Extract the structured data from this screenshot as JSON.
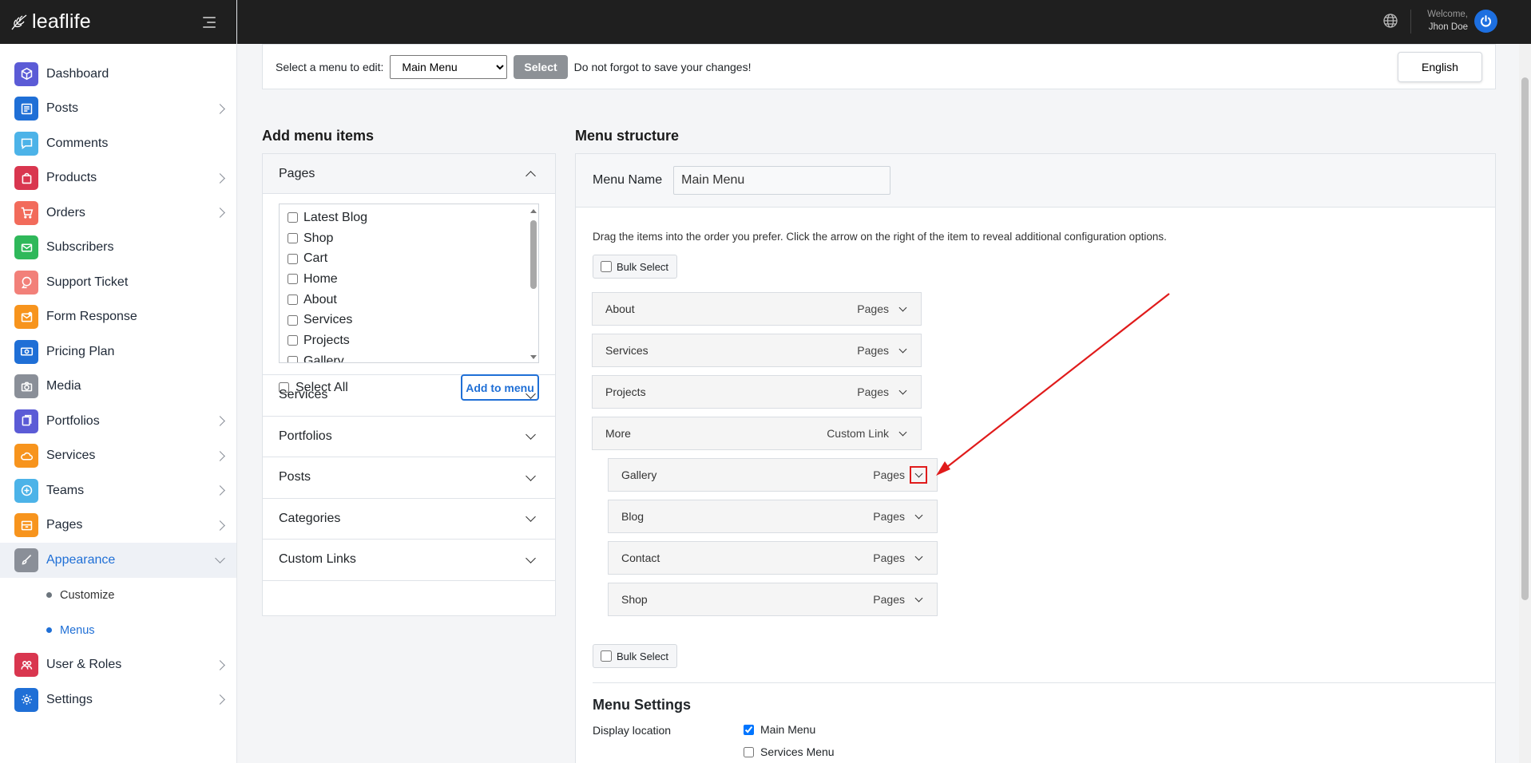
{
  "brand": {
    "name": "leaflife"
  },
  "sidebar": {
    "items": [
      {
        "label": "Dashboard",
        "icon": "cube-icon",
        "color": "#5b5bd6",
        "has_children": false
      },
      {
        "label": "Posts",
        "icon": "newspaper-icon",
        "color": "#1f6fd6",
        "has_children": true
      },
      {
        "label": "Comments",
        "icon": "comment-icon",
        "color": "#4cb3e8",
        "has_children": false
      },
      {
        "label": "Products",
        "icon": "bag-icon",
        "color": "#d9364f",
        "has_children": true
      },
      {
        "label": "Orders",
        "icon": "cart-icon",
        "color": "#f26b5b",
        "has_children": true
      },
      {
        "label": "Subscribers",
        "icon": "mail-icon",
        "color": "#2fb85a",
        "has_children": false
      },
      {
        "label": "Support Ticket",
        "icon": "support-icon",
        "color": "#f28079",
        "has_children": false
      },
      {
        "label": "Form Response",
        "icon": "mail-open-icon",
        "color": "#f7941d",
        "has_children": false
      },
      {
        "label": "Pricing Plan",
        "icon": "money-icon",
        "color": "#1f6fd6",
        "has_children": false
      },
      {
        "label": "Media",
        "icon": "camera-icon",
        "color": "#8a8f98",
        "has_children": false
      },
      {
        "label": "Portfolios",
        "icon": "portfolio-icon",
        "color": "#5b5bd6",
        "has_children": true
      },
      {
        "label": "Services",
        "icon": "cloud-icon",
        "color": "#f7941d",
        "has_children": true
      },
      {
        "label": "Teams",
        "icon": "plus-circle-icon",
        "color": "#4cb3e8",
        "has_children": true
      },
      {
        "label": "Pages",
        "icon": "pages-icon",
        "color": "#f7941d",
        "has_children": true
      },
      {
        "label": "Appearance",
        "icon": "brush-icon",
        "color": "#8a8f98",
        "has_children": true,
        "active": true
      },
      {
        "label": "User & Roles",
        "icon": "users-icon",
        "color": "#d9364f",
        "has_children": true
      },
      {
        "label": "Settings",
        "icon": "gear-icon",
        "color": "#1f6fd6",
        "has_children": true
      }
    ],
    "appearance_sub": [
      {
        "label": "Customize"
      },
      {
        "label": "Menus",
        "active": true
      }
    ]
  },
  "topbar": {
    "welcome": "Welcome,",
    "user": "Jhon Doe"
  },
  "selector": {
    "label": "Select a menu to edit:",
    "selected": "Main Menu",
    "select_button": "Select",
    "note": "Do not forgot to save your changes!",
    "language": "English"
  },
  "add_items": {
    "title": "Add menu items",
    "pages_label": "Pages",
    "pages": [
      "Latest Blog",
      "Shop",
      "Cart",
      "Home",
      "About",
      "Services",
      "Projects",
      "Gallery"
    ],
    "select_all": "Select All",
    "add_button": "Add to menu",
    "sections": [
      "Services",
      "Portfolios",
      "Posts",
      "Categories",
      "Custom Links"
    ]
  },
  "structure": {
    "title": "Menu structure",
    "name_label": "Menu Name",
    "name_value": "Main Menu",
    "hint": "Drag the items into the order you prefer. Click the arrow on the right of the item to reveal additional configuration options.",
    "bulk_select": "Bulk Select",
    "items": [
      {
        "label": "About",
        "type": "Pages",
        "level": 0
      },
      {
        "label": "Services",
        "type": "Pages",
        "level": 0
      },
      {
        "label": "Projects",
        "type": "Pages",
        "level": 0
      },
      {
        "label": "More",
        "type": "Custom Link",
        "level": 0
      },
      {
        "label": "Gallery",
        "type": "Pages",
        "level": 1,
        "highlighted": true
      },
      {
        "label": "Blog",
        "type": "Pages",
        "level": 1
      },
      {
        "label": "Contact",
        "type": "Pages",
        "level": 1
      },
      {
        "label": "Shop",
        "type": "Pages",
        "level": 1
      }
    ]
  },
  "settings": {
    "title": "Menu Settings",
    "display_label": "Display location",
    "locations": [
      {
        "label": "Main Menu",
        "checked": true
      },
      {
        "label": "Services Menu",
        "checked": false
      }
    ]
  },
  "colors": {
    "accent": "#1f6fd6",
    "annotation": "#e01b1b",
    "topbar": "#1f1f1f"
  }
}
